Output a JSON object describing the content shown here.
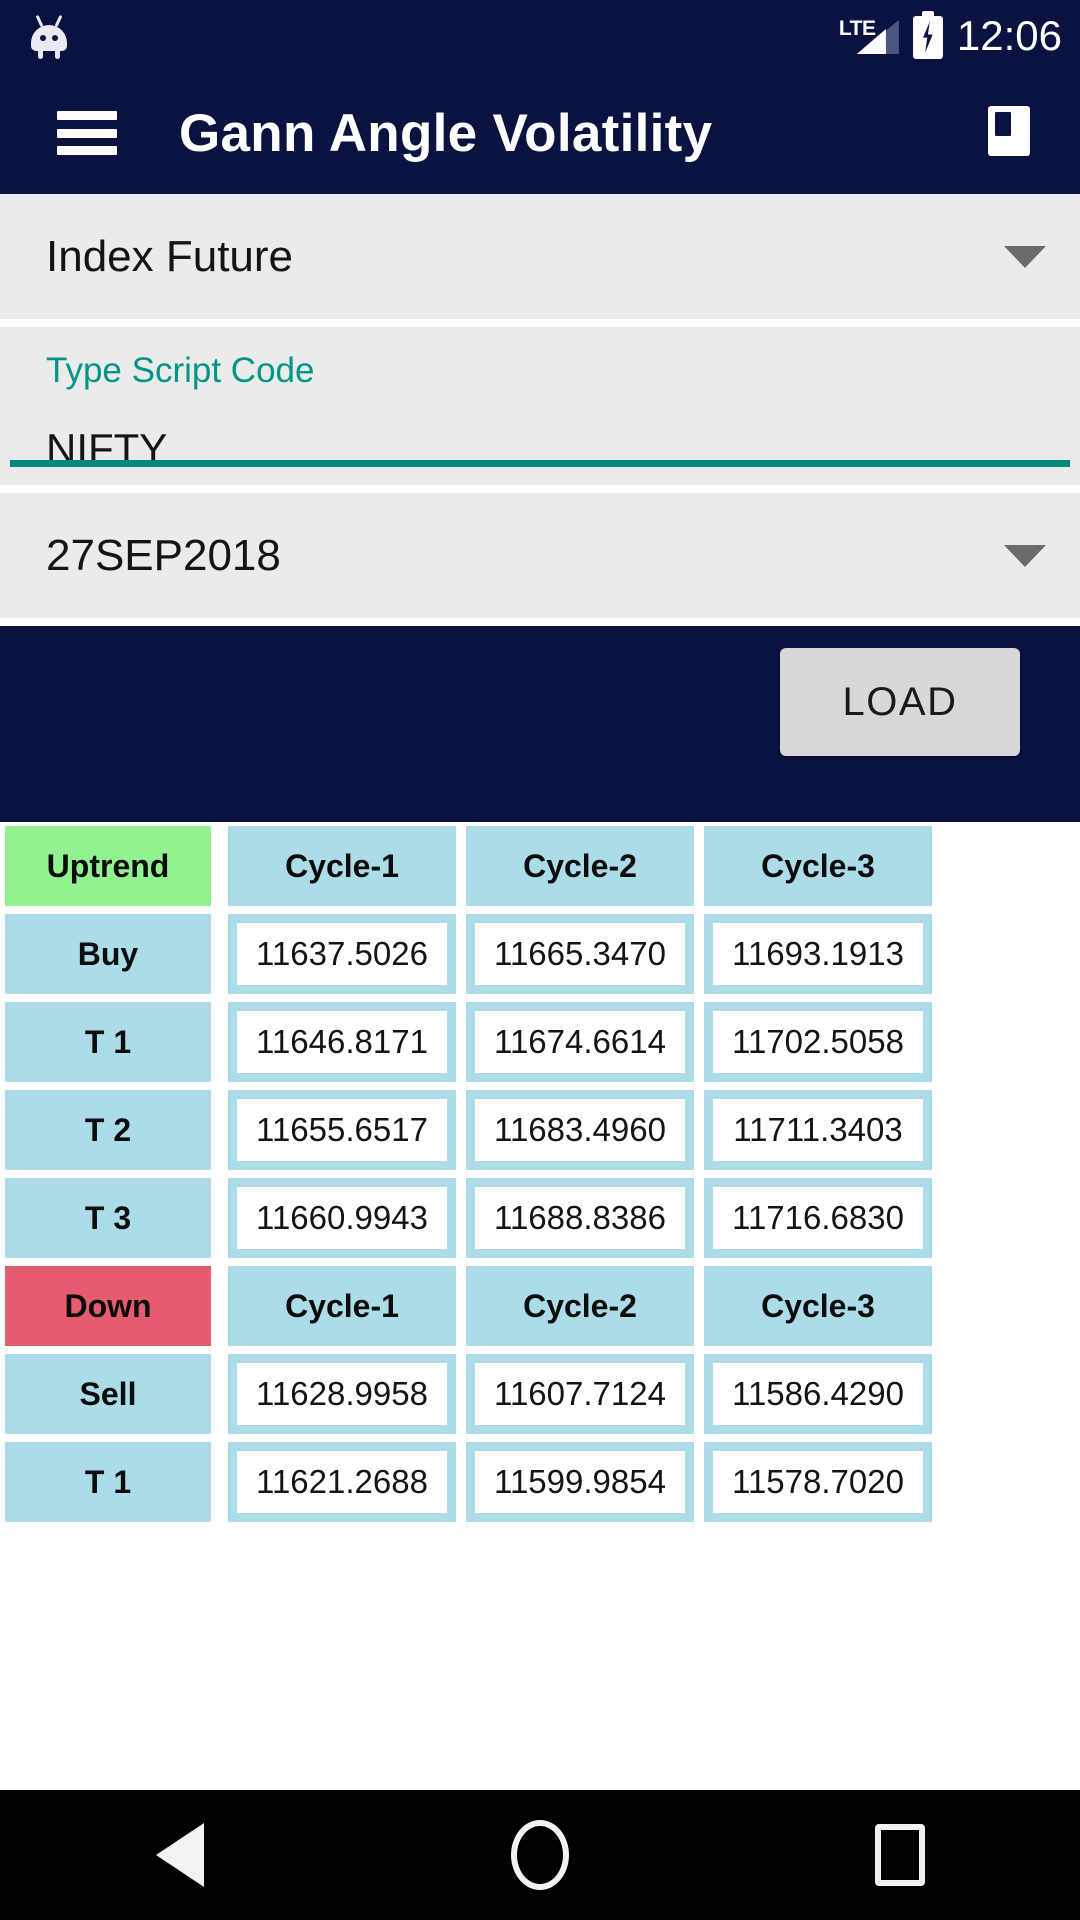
{
  "status_bar": {
    "network": "LTE",
    "time": "12:06",
    "battery_icon": "battery-charging-icon",
    "notification_icon": "android-robot-icon"
  },
  "app_bar": {
    "menu_icon": "hamburger-menu-icon",
    "title": "Gann Angle Volatility",
    "action_icon": "bookmark-icon"
  },
  "form": {
    "segment": {
      "value": "Index Future",
      "caret_icon": "chevron-down-icon"
    },
    "script": {
      "label": "Type Script Code",
      "value": "NIFTY"
    },
    "expiry": {
      "value": "27SEP2018",
      "caret_icon": "chevron-down-icon"
    },
    "load_label": "LOAD"
  },
  "colors": {
    "primary_dark": "#0a1240",
    "accent_teal": "#00897b",
    "uptrend_green": "#92f28f",
    "down_red": "#e45c6e",
    "cell_blue": "#addce9",
    "field_grey": "#ebebeb",
    "button_grey": "#d8d8d8"
  },
  "table": {
    "uptrend": {
      "header": [
        "Uptrend",
        "Cycle-1",
        "Cycle-2",
        "Cycle-3"
      ],
      "rows": [
        {
          "label": "Buy",
          "values": [
            "11637.5026",
            "11665.3470",
            "11693.1913"
          ]
        },
        {
          "label": "T 1",
          "values": [
            "11646.8171",
            "11674.6614",
            "11702.5058"
          ]
        },
        {
          "label": "T 2",
          "values": [
            "11655.6517",
            "11683.4960",
            "11711.3403"
          ]
        },
        {
          "label": "T 3",
          "values": [
            "11660.9943",
            "11688.8386",
            "11716.6830"
          ]
        }
      ]
    },
    "downtrend": {
      "header": [
        "Down",
        "Cycle-1",
        "Cycle-2",
        "Cycle-3"
      ],
      "rows": [
        {
          "label": "Sell",
          "values": [
            "11628.9958",
            "11607.7124",
            "11586.4290"
          ]
        },
        {
          "label": "T 1",
          "values": [
            "11621.2688",
            "11599.9854",
            "11578.7020"
          ]
        }
      ]
    }
  },
  "nav_bar": {
    "back_icon": "back-triangle-icon",
    "home_icon": "home-circle-icon",
    "recents_icon": "recents-square-icon"
  }
}
